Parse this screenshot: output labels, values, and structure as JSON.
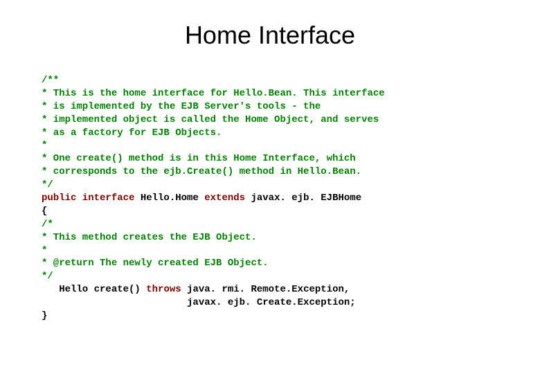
{
  "title": "Home Interface",
  "code": {
    "c1": "/**",
    "c2": "* This is the home interface for Hello.Bean. This interface",
    "c3": "* is implemented by the EJB Server's tools - the",
    "c4": "* implemented object is called the Home Object, and serves",
    "c5": "* as a factory for EJB Objects.",
    "c6": "*",
    "c7": "* One create() method is in this Home Interface, which",
    "c8": "* corresponds to the ejb.Create() method in Hello.Bean.",
    "c9": "*/",
    "kw1": "public interface",
    "p1": " Hello.Home ",
    "kw2": "extends",
    "p2": " javax. ejb. EJBHome",
    "p3": "{",
    "c10": "/*",
    "c11": "* This method creates the EJB Object.",
    "c12": "*",
    "c13": "* @return The newly created EJB Object.",
    "c14": "*/",
    "p4": "   Hello create() ",
    "kw3": "throws",
    "p5": " java. rmi. Remote.Exception,",
    "p6": "                         javax. ejb. Create.Exception;",
    "p7": "}"
  }
}
